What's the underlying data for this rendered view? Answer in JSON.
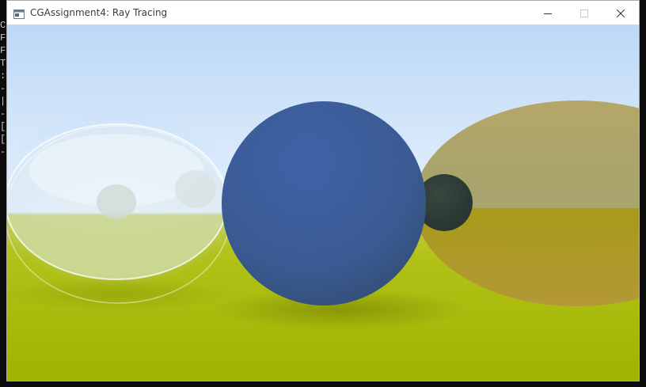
{
  "window": {
    "title": "CGAssignment4: Ray Tracing",
    "icon": "console-window-icon",
    "controls": {
      "minimize_icon": "minimize-icon",
      "maximize_icon": "maximize-icon",
      "close_icon": "close-icon"
    }
  },
  "background_console": {
    "lines": [
      "C",
      "F",
      "F",
      "T",
      ":",
      "-",
      "|",
      "-",
      "[",
      "[",
      "-"
    ]
  },
  "scene": {
    "description_colors": {
      "sky_top": "#bcd8f6",
      "sky_horizon": "#e6f1fc",
      "ground_near": "#a8bd00",
      "ground_far": "#c4cc4a",
      "center_sphere": "#3a5c9a",
      "small_sphere": "#2f423c",
      "right_sphere": "#b9a455",
      "glass_sphere": "#e4eef2"
    }
  }
}
